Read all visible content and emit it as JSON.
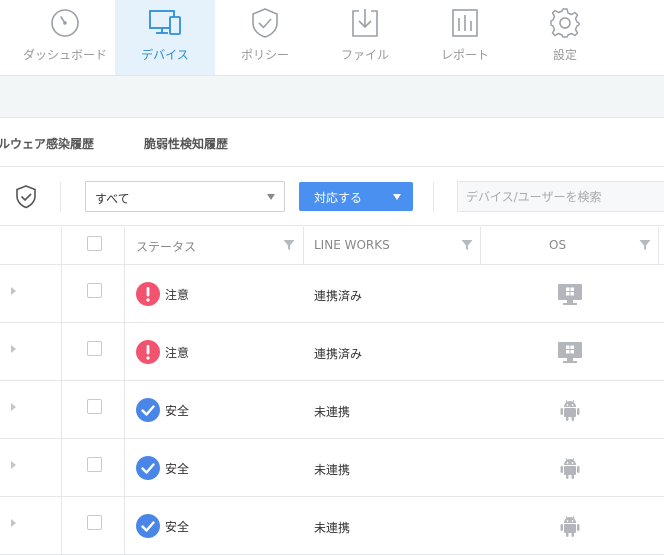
{
  "nav": {
    "items": [
      {
        "label": "ダッシュボード",
        "icon": "dashboard-gauge-icon"
      },
      {
        "label": "デバイス",
        "icon": "device-monitor-icon",
        "active": true
      },
      {
        "label": "ポリシー",
        "icon": "policy-shield-icon"
      },
      {
        "label": "ファイル",
        "icon": "file-download-icon"
      },
      {
        "label": "レポート",
        "icon": "report-chart-icon"
      },
      {
        "label": "設定",
        "icon": "settings-gear-icon"
      }
    ]
  },
  "subtabs": {
    "malware_history": "ルウェア感染履歴",
    "vulnerability_history": "脆弱性検知履歴"
  },
  "toolbar": {
    "filter_select_value": "すべて",
    "action_button_label": "対応する",
    "search_placeholder": "デバイス/ユーザーを検索"
  },
  "table": {
    "headers": {
      "status": "ステータス",
      "line_works": "LINE WORKS",
      "os": "OS"
    },
    "rows": [
      {
        "status": "注意",
        "status_type": "warning",
        "line_works": "連携済み",
        "os": "windows"
      },
      {
        "status": "注意",
        "status_type": "warning",
        "line_works": "連携済み",
        "os": "windows"
      },
      {
        "status": "安全",
        "status_type": "safe",
        "line_works": "未連携",
        "os": "android"
      },
      {
        "status": "安全",
        "status_type": "safe",
        "line_works": "未連携",
        "os": "android"
      },
      {
        "status": "安全",
        "status_type": "safe",
        "line_works": "未連携",
        "os": "android"
      }
    ]
  },
  "colors": {
    "accent": "#4a90f0",
    "nav_active_bg": "#e5f2fb",
    "nav_active_text": "#2b8fd9",
    "warning": "#f2536f",
    "safe": "#4a86e8",
    "os_icon": "#b3b7bc"
  }
}
